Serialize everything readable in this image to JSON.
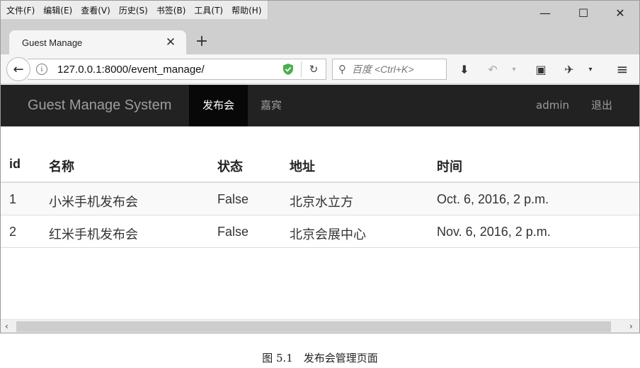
{
  "menubar": {
    "items": [
      "文件(F)",
      "编辑(E)",
      "查看(V)",
      "历史(S)",
      "书签(B)",
      "工具(T)",
      "帮助(H)"
    ]
  },
  "window_controls": {
    "minimize": "—",
    "maximize": "☐",
    "close": "✕"
  },
  "tab": {
    "title": "Guest Manage",
    "close": "✕",
    "new_tab": "+"
  },
  "toolbar": {
    "url": "127.0.0.1:8000/event_manage/",
    "search_placeholder": "百度 <Ctrl+K>"
  },
  "navbar": {
    "brand": "Guest Manage System",
    "links": [
      "发布会",
      "嘉宾"
    ],
    "active_index": 0,
    "user": "admin",
    "logout": "退出"
  },
  "table": {
    "headers": [
      "id",
      "名称",
      "状态",
      "地址",
      "时间"
    ],
    "rows": [
      [
        "1",
        "小米手机发布会",
        "False",
        "北京水立方",
        "Oct. 6, 2016, 2 p.m."
      ],
      [
        "2",
        "红米手机发布会",
        "False",
        "北京会展中心",
        "Nov. 6, 2016, 2 p.m."
      ]
    ]
  },
  "caption": "图 5.1　发布会管理页面",
  "colors": {
    "navbar_bg": "#222222",
    "active_link_bg": "#080808",
    "shield": "#4caf50"
  }
}
